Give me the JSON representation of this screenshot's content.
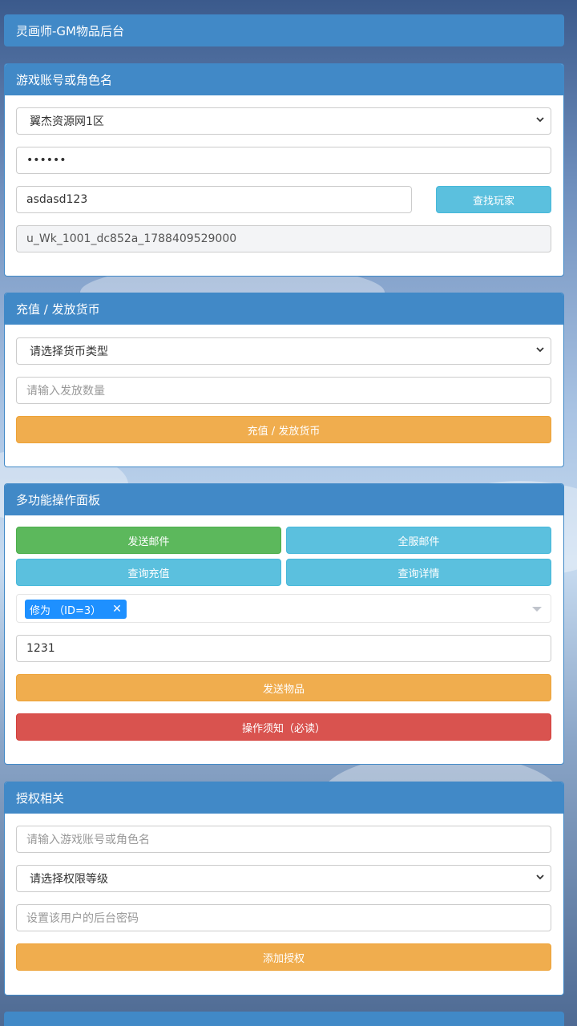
{
  "header": {
    "title": "灵画师-GM物品后台"
  },
  "account_panel": {
    "title": "游戏账号或角色名",
    "server_select": "翼杰资源网1区",
    "password_value": "••••••",
    "player_input": "asdasd123",
    "find_player_label": "查找玩家",
    "uid_value": "u_Wk_1001_dc852a_1788409529000"
  },
  "currency_panel": {
    "title": "充值 / 发放货币",
    "currency_type_placeholder": "请选择货币类型",
    "amount_placeholder": "请输入发放数量",
    "submit_label": "充值 / 发放货币"
  },
  "multi_panel": {
    "title": "多功能操作面板",
    "buttons": {
      "send_mail": "发送邮件",
      "all_server_mail": "全服邮件",
      "query_recharge": "查询充值",
      "query_details": "查询详情"
    },
    "selected_item_tag": "修为 （ID=3）",
    "quantity_value": "1231",
    "send_item_label": "发送物品",
    "notice_label": "操作须知（必读）"
  },
  "auth_panel": {
    "title": "授权相关",
    "account_placeholder": "请输入游戏账号或角色名",
    "level_placeholder": "请选择权限等级",
    "password_placeholder": "设置该用户的后台密码",
    "add_auth_label": "添加授权"
  },
  "colors": {
    "primary": "#4189c7",
    "orange": "#f0ad4e",
    "info": "#5bc0de",
    "green": "#5cb85c",
    "red": "#d9534f",
    "tag": "#1e90ff"
  }
}
